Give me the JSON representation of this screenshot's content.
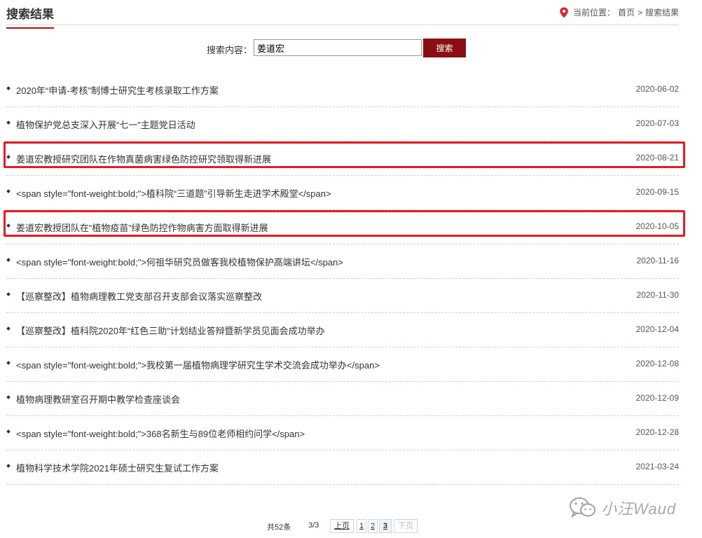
{
  "header": {
    "title": "搜索结果",
    "breadcrumb": {
      "prefix": "当前位置：",
      "home": "首页",
      "separator": ">",
      "current": "搜索结果"
    }
  },
  "search": {
    "label": "搜索内容：",
    "value": "姜道宏",
    "button": "搜索"
  },
  "results": [
    {
      "title": "2020年“申请-考核”制博士研究生考核录取工作方案",
      "date": "2020-06-02",
      "highlighted": false
    },
    {
      "title": "植物保护党总支深入开展“七一”主题党日活动",
      "date": "2020-07-03",
      "highlighted": false
    },
    {
      "title": "姜道宏教授研究团队在作物真菌病害绿色防控研究领取得新进展",
      "date": "2020-08-21",
      "highlighted": true
    },
    {
      "title": "<span style=\"font-weight:bold;\">植科院“三道题”引导新生走进学术殿堂</span>",
      "date": "2020-09-15",
      "highlighted": false
    },
    {
      "title": "姜道宏教授团队在“植物疫苗”绿色防控作物病害方面取得新进展",
      "date": "2020-10-05",
      "highlighted": true
    },
    {
      "title": "<span style=\"font-weight:bold;\">何祖华研究员做客我校植物保护高端讲坛</span>",
      "date": "2020-11-16",
      "highlighted": false
    },
    {
      "title": "【巡察整改】植物病理教工党支部召开支部会议落实巡察整改",
      "date": "2020-11-30",
      "highlighted": false
    },
    {
      "title": "【巡察整改】植科院2020年“红色三助”计划结业答辩暨新学员见面会成功举办",
      "date": "2020-12-04",
      "highlighted": false
    },
    {
      "title": "<span style=\"font-weight:bold;\">我校第一届植物病理学研究生学术交流会成功举办</span>",
      "date": "2020-12-08",
      "highlighted": false
    },
    {
      "title": "植物病理教研室召开期中教学检查座谈会",
      "date": "2020-12-09",
      "highlighted": false
    },
    {
      "title": "<span style=\"font-weight:bold;\">368名新生与89位老师相约问学</span>",
      "date": "2020-12-28",
      "highlighted": false
    },
    {
      "title": "植物科学技术学院2021年硕士研究生复试工作方案",
      "date": "2021-03-24",
      "highlighted": false
    }
  ],
  "pagination": {
    "total": "共52条",
    "page_info": "3/3",
    "prev": "上页",
    "pages": [
      "1",
      "2",
      "3"
    ],
    "current": "3",
    "next": "下页"
  },
  "watermark": {
    "text": "小汪Waud",
    "icon": "wechat-icon"
  },
  "colors": {
    "accent": "#8b0e12",
    "highlight": "#e31b23",
    "pin": "#d9232d"
  }
}
